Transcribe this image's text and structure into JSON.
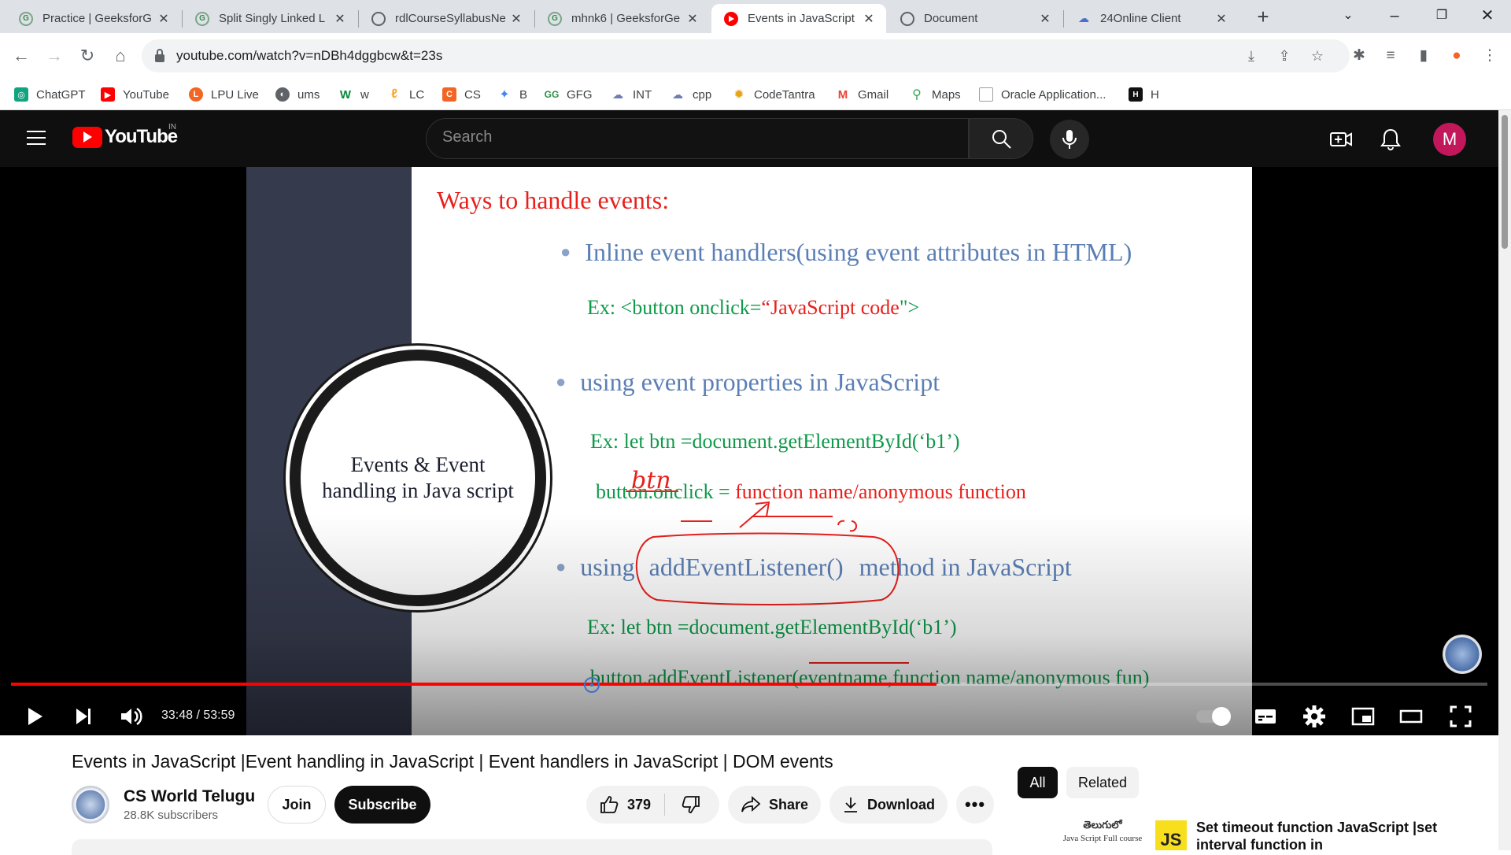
{
  "browser": {
    "tabs": [
      {
        "title": "Practice | GeeksforG",
        "favicon": "gfg-icon"
      },
      {
        "title": "Split Singly Linked L",
        "favicon": "gfg-icon"
      },
      {
        "title": "rdlCourseSyllabusNe",
        "favicon": "globe-icon"
      },
      {
        "title": "mhnk6 | GeeksforGe",
        "favicon": "gfg-icon"
      },
      {
        "title": "Events in JavaScript",
        "favicon": "youtube-icon",
        "active": true
      },
      {
        "title": "Document",
        "favicon": "globe-icon"
      },
      {
        "title": "24Online Client",
        "favicon": "cloud-icon"
      }
    ],
    "url": "youtube.com/watch?v=nDBh4dggbcw&t=23s",
    "bookmarks": [
      {
        "label": "ChatGPT",
        "color": "#10a37f"
      },
      {
        "label": "YouTube",
        "color": "#ff0000"
      },
      {
        "label": "LPU Live",
        "color": "#f26522"
      },
      {
        "label": "ums",
        "color": "#5f6368"
      },
      {
        "label": "w",
        "color": "#0a8a3c"
      },
      {
        "label": "LC",
        "color": "#ffa116"
      },
      {
        "label": "CS",
        "color": "#f26522"
      },
      {
        "label": "B",
        "color": "#4285f4"
      },
      {
        "label": "GFG",
        "color": "#2f8d46"
      },
      {
        "label": "INT",
        "color": "#6c7fb2"
      },
      {
        "label": "cpp",
        "color": "#6c7fb2"
      },
      {
        "label": "CodeTantra",
        "color": "#e8a317"
      },
      {
        "label": "Gmail",
        "color": "#ea4335"
      },
      {
        "label": "Maps",
        "color": "#34a853"
      },
      {
        "label": "Oracle Application...",
        "color": "#9aa0a6"
      },
      {
        "label": "H",
        "color": "#111111"
      }
    ]
  },
  "youtube": {
    "country_code": "IN",
    "logo_text": "YouTube",
    "search_placeholder": "Search",
    "avatar_letter": "M"
  },
  "video": {
    "slide": {
      "title": "Ways to handle events:",
      "circle_text": "Events & Event handling in Java script",
      "bullet1": "Inline event handlers(using  event attributes in HTML)",
      "ex1_prefix": "Ex:  <button onclick=",
      "ex1_value": "“JavaScript code",
      "ex1_suffix": "\">",
      "bullet2": "using  event properties in JavaScript",
      "ex2": "Ex: let btn =document.getElementById(‘b1’)",
      "ex3_prefix": "button.onclick = ",
      "ex3_value": "function name/anonymous function",
      "bullet3_a": "using",
      "bullet3_b": "addEventListener()",
      "bullet3_c": "method in JavaScript",
      "ex4": "Ex: let btn =document.getElementById(‘b1’)",
      "ex5": "button.addEventListener(eventname,function name/anonymous fun)",
      "handwriting": "btn"
    },
    "time_display": "33:48 / 53:59",
    "progress_fraction": 0.627,
    "title": "Events in JavaScript |Event handling in JavaScript | Event handlers in JavaScript | DOM events"
  },
  "channel": {
    "name": "CS World Telugu",
    "subscribers": "28.8K subscribers",
    "join_label": "Join",
    "subscribe_label": "Subscribe"
  },
  "actions": {
    "likes": "379",
    "share_label": "Share",
    "download_label": "Download"
  },
  "sidebar": {
    "chips": [
      "All",
      "Related"
    ],
    "rec_thumb_text_1": "తెలుగులో",
    "rec_thumb_text_2": "Java Script Full course",
    "rec_thumb_badge": "JS",
    "rec_title": "Set timeout function JavaScript |set interval function in"
  }
}
